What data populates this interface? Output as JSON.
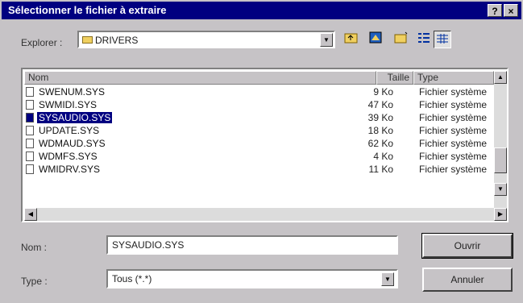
{
  "window": {
    "title": "Sélectionner le fichier à extraire",
    "help_label": "?",
    "close_label": "×"
  },
  "explorer": {
    "label": "Explorer :",
    "current_folder": "DRIVERS"
  },
  "toolbar": {
    "icons": [
      "up-folder-icon",
      "desktop-icon",
      "new-folder-icon",
      "list-view-icon",
      "details-view-icon"
    ]
  },
  "file_list": {
    "columns": {
      "name": "Nom",
      "size": "Taille",
      "type": "Type"
    },
    "rows": [
      {
        "name": "SWENUM.SYS",
        "size": "9 Ko",
        "type": "Fichier système",
        "selected": false
      },
      {
        "name": "SWMIDI.SYS",
        "size": "47 Ko",
        "type": "Fichier système",
        "selected": false
      },
      {
        "name": "SYSAUDIO.SYS",
        "size": "39 Ko",
        "type": "Fichier système",
        "selected": true
      },
      {
        "name": "UPDATE.SYS",
        "size": "18 Ko",
        "type": "Fichier système",
        "selected": false
      },
      {
        "name": "WDMAUD.SYS",
        "size": "62 Ko",
        "type": "Fichier système",
        "selected": false
      },
      {
        "name": "WDMFS.SYS",
        "size": "4 Ko",
        "type": "Fichier système",
        "selected": false
      },
      {
        "name": "WMIDRV.SYS",
        "size": "11 Ko",
        "type": "Fichier système",
        "selected": false
      }
    ]
  },
  "form": {
    "name_label": "Nom :",
    "name_value": "SYSAUDIO.SYS",
    "type_label": "Type :",
    "type_value": "Tous (*.*)"
  },
  "buttons": {
    "open": "Ouvrir",
    "cancel": "Annuler"
  },
  "colors": {
    "titlebar": "#000080",
    "face": "#c6c3c6",
    "selection": "#000080"
  }
}
